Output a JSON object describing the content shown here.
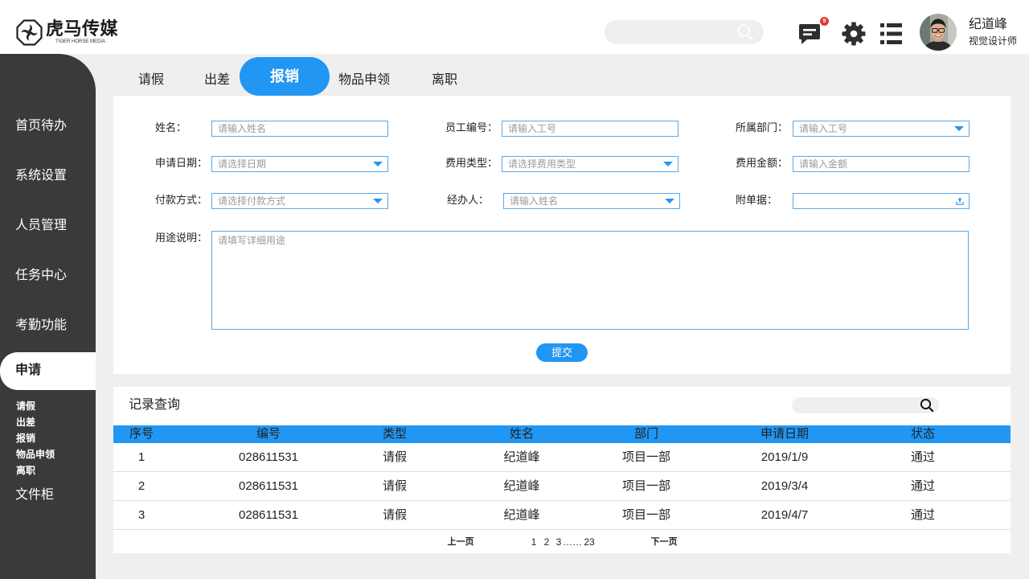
{
  "colors": {
    "accent": "#2196f3",
    "sidebar_bg": "#3a3a3a",
    "page_bg": "#efefef",
    "badge": "#e8363b",
    "input_border": "#5aa8e8",
    "divider": "#dddddd"
  },
  "icons": {
    "logo": "logo-icon",
    "search": "search-icon",
    "messages": "message-icon",
    "settings": "gear-icon",
    "menu": "list-menu-icon",
    "dropdown": "caret-down-icon",
    "upload": "upload-icon"
  },
  "header": {
    "brand_name": "虎马传媒",
    "brand_tagline": "TIGER HORSE MEDIA",
    "message_badge_count": "9",
    "user": {
      "name": "纪道峰",
      "role": "视觉设计师"
    }
  },
  "sidebar": {
    "items": [
      {
        "label": "首页待办"
      },
      {
        "label": "系统设置"
      },
      {
        "label": "人员管理"
      },
      {
        "label": "任务中心"
      },
      {
        "label": "考勤功能"
      },
      {
        "label": "申请",
        "active": true
      },
      {
        "label": "文件柜"
      }
    ],
    "sub_items": [
      "请假",
      "出差",
      "报销",
      "物品申领",
      "离职"
    ]
  },
  "tabs": [
    {
      "label": "请假"
    },
    {
      "label": "出差"
    },
    {
      "label": "报销",
      "active": true
    },
    {
      "label": "物品申领"
    },
    {
      "label": "离职"
    }
  ],
  "form": {
    "fields": [
      {
        "label": "姓名：",
        "placeholder": "请输入姓名"
      },
      {
        "label": "员工编号：",
        "placeholder": "请输入工号"
      },
      {
        "label": "所属部门：",
        "placeholder": "请输入工号"
      },
      {
        "label": "申请日期：",
        "placeholder": "请选择日期"
      },
      {
        "label": "费用类型：",
        "placeholder": "请选择费用类型"
      },
      {
        "label": "费用金额：",
        "placeholder": "请输入金额"
      },
      {
        "label": "付款方式：",
        "placeholder": "请选择付款方式"
      },
      {
        "label": "经办人：",
        "placeholder": "请输入姓名"
      },
      {
        "label": "附单据："
      }
    ],
    "purpose": {
      "label": "用途说明：",
      "placeholder": "请填写详细用途"
    },
    "submit_label": "提交"
  },
  "records": {
    "title": "记录查询",
    "columns": [
      "序号",
      "编号",
      "类型",
      "姓名",
      "部门",
      "申请日期",
      "状态"
    ],
    "rows": [
      [
        "1",
        "028611531",
        "请假",
        "纪道峰",
        "项目一部",
        "2019/1/9",
        "通过"
      ],
      [
        "2",
        "028611531",
        "请假",
        "纪道峰",
        "项目一部",
        "2019/3/4",
        "通过"
      ],
      [
        "3",
        "028611531",
        "请假",
        "纪道峰",
        "项目一部",
        "2019/4/7",
        "通过"
      ]
    ],
    "pagination": {
      "prev_label": "上一页",
      "pages": [
        "1",
        "2",
        "3"
      ],
      "ellipsis": "……",
      "last_page": "23",
      "next_label": "下一页"
    }
  }
}
